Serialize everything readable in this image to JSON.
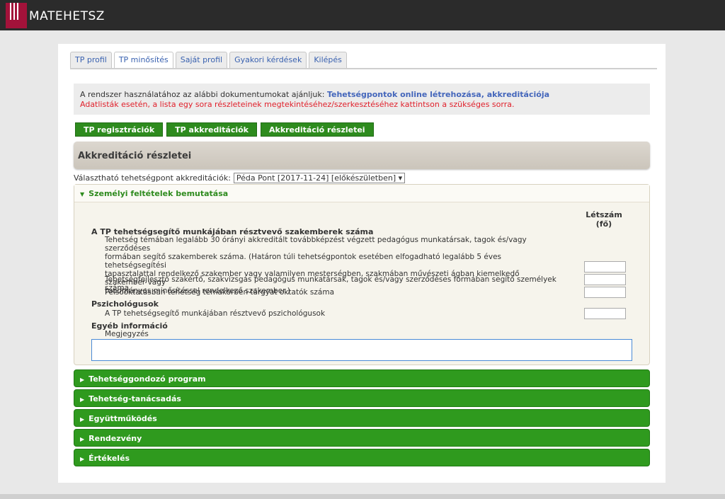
{
  "brand": {
    "name": "MATEHETSZ"
  },
  "tabs": [
    {
      "label": "TP profil",
      "active": false
    },
    {
      "label": "TP minősítés",
      "active": true
    },
    {
      "label": "Saját profil",
      "active": false
    },
    {
      "label": "Gyakori kérdések",
      "active": false
    },
    {
      "label": "Kilépés",
      "active": false
    }
  ],
  "info": {
    "prefix": "A rendszer használatához az alábbi dokumentumokat ajánljuk:",
    "link": "Tehetségpontok online létrehozása, akkreditációja",
    "warning": "Adatlisták esetén, a lista egy sora részleteinek megtekintéséhez/szerkesztéséhez kattintson a szükséges sorra."
  },
  "buttons": {
    "registrations": "TP regisztrációk",
    "accreditations": "TP akkreditációk",
    "details": "Akkreditáció részletei"
  },
  "panel_title": "Akkreditáció részletei",
  "selector": {
    "label": "Választható tehetségpont akkreditációk:",
    "value": "Péda Pont [2017-11-24] [előkészületben] ▾"
  },
  "open_section": {
    "title": "Személyi feltételek bemutatása",
    "count_header_1": "Létszám",
    "count_header_2": "(fő)",
    "group1_title": "A TP tehetségsegítő munkájában résztvevő szakemberek száma",
    "row1_l1": "Tehetség témában legalább 30 órányi akkreditált továbbképzést végzett pedagógus munkatársak, tagok és/vagy szerződéses",
    "row1_l2": "formában segítő szakemberek száma. (Határon túli tehetségpontok esetében elfogadható legalább 5 éves tehetségsegítési",
    "row1_l3": "tapasztalattal rendelkező szakember vagy valamilyen mesterségben, szakmában művészeti ágban kiemelkedő szakember vagy",
    "row1_l4": "tudományos minősítéssel rendelkező szakember.)",
    "row2": "Tehetségfejlesztő szakértő, szakvizsgás pedagógus munkatársak, tagok és/vagy szerződéses formában segítő személyek száma",
    "row3": "Felsőoktatásban tehetség témakörben tárgyat oktatók száma",
    "group2_title": "Pszichológusok",
    "row4": "A TP tehetségsegítő munkájában résztvevő pszichológusok",
    "group3_title": "Egyéb információ",
    "note_label": "Megjegyzés"
  },
  "collapsed_sections": [
    "Tehetséggondozó program",
    "Tehetség-tanácsadás",
    "Együttműködés",
    "Rendezvény",
    "Értékelés"
  ],
  "colors": {
    "green": "#2f9a1e",
    "topbar": "#2b2b2b",
    "brand_red": "#a3123a",
    "link_blue": "#4466bb",
    "warning_red": "#e0202b"
  }
}
